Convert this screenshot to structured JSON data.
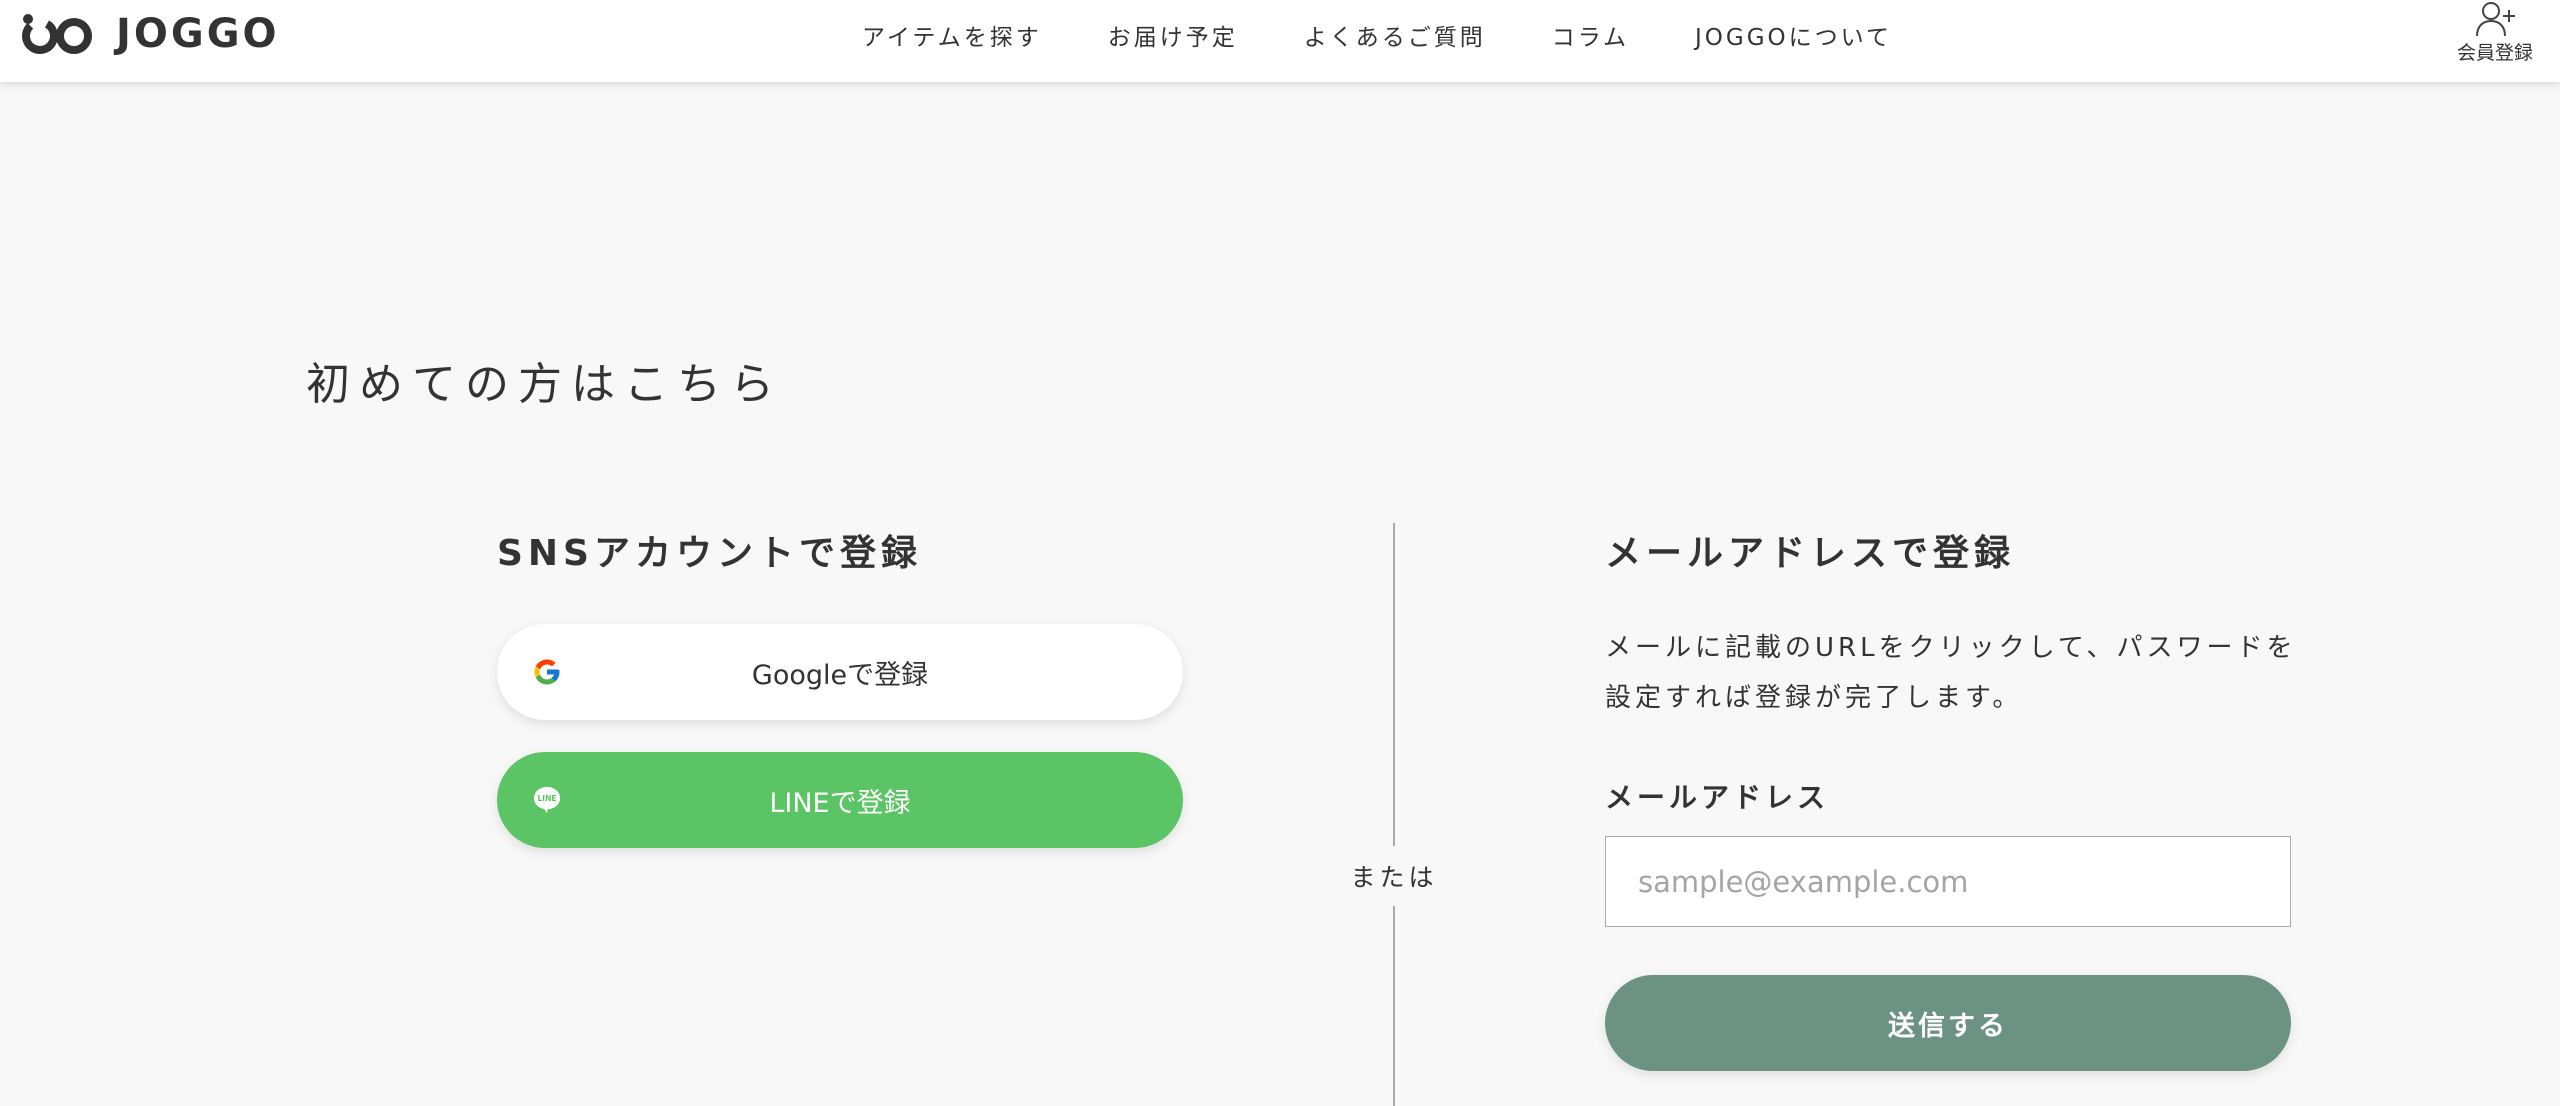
{
  "header": {
    "logo_text": "JOGGO",
    "nav": [
      "アイテムを探す",
      "お届け予定",
      "よくあるご質問",
      "コラム",
      "JOGGOについて"
    ],
    "account_label": "会員登録"
  },
  "main": {
    "heading": "初めての方はこちら",
    "sns": {
      "title": "SNSアカウントで登録",
      "google_label": "Googleで登録",
      "line_label": "LINEで登録",
      "line_icon_text": "LINE"
    },
    "or_text": "または",
    "mail": {
      "title": "メールアドレスで登録",
      "desc_line1": "メールに記載のURLをクリックして、パスワードを",
      "desc_line2": "設定すれば登録が完了します。",
      "field_label": "メールアドレス",
      "input_value": "",
      "input_placeholder": "sample@example.com",
      "submit_label": "送信する"
    }
  },
  "colors": {
    "line_green": "#5bc464",
    "submit_green": "#6b9282",
    "background": "#f8f8f8"
  }
}
